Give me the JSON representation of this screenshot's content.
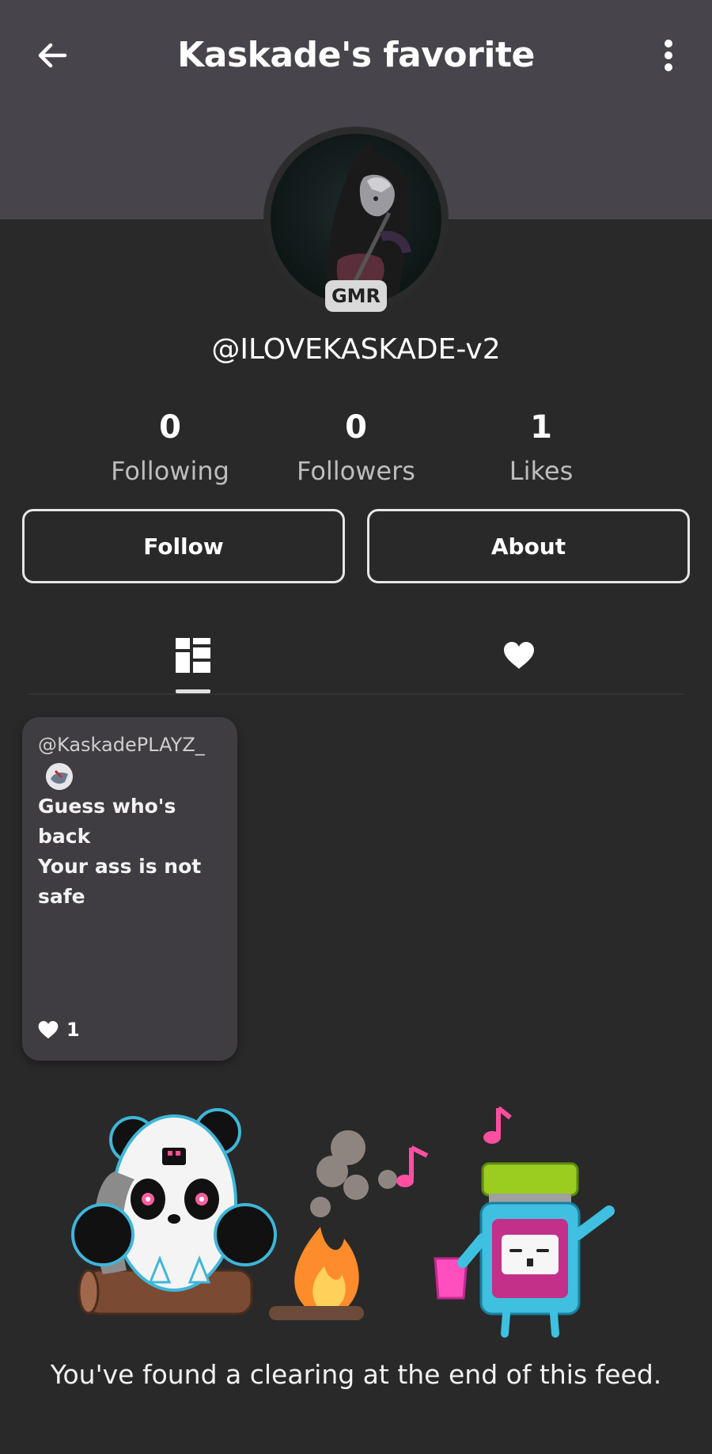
{
  "header": {
    "title": "Kaskade's favorite",
    "back_icon": "arrow-left-icon",
    "menu_icon": "more-vertical-icon"
  },
  "profile": {
    "badge": "GMR",
    "username": "@ILOVEKASKADE-v2"
  },
  "stats": [
    {
      "value": "0",
      "label": "Following"
    },
    {
      "value": "0",
      "label": "Followers"
    },
    {
      "value": "1",
      "label": "Likes"
    }
  ],
  "actions": {
    "follow_label": "Follow",
    "about_label": "About"
  },
  "tabs": [
    {
      "icon": "grid-icon",
      "selected": true
    },
    {
      "icon": "heart-icon",
      "selected": false
    }
  ],
  "posts": [
    {
      "author": "@KaskadePLAYZ_",
      "text": "Guess who's back\nYour ass is not\nsafe",
      "likes": "1"
    }
  ],
  "footer": {
    "end_message": "You've found a clearing at the end of this feed."
  },
  "colors": {
    "background": "#292929",
    "header_band": "#48444b",
    "card": "#403d42"
  }
}
